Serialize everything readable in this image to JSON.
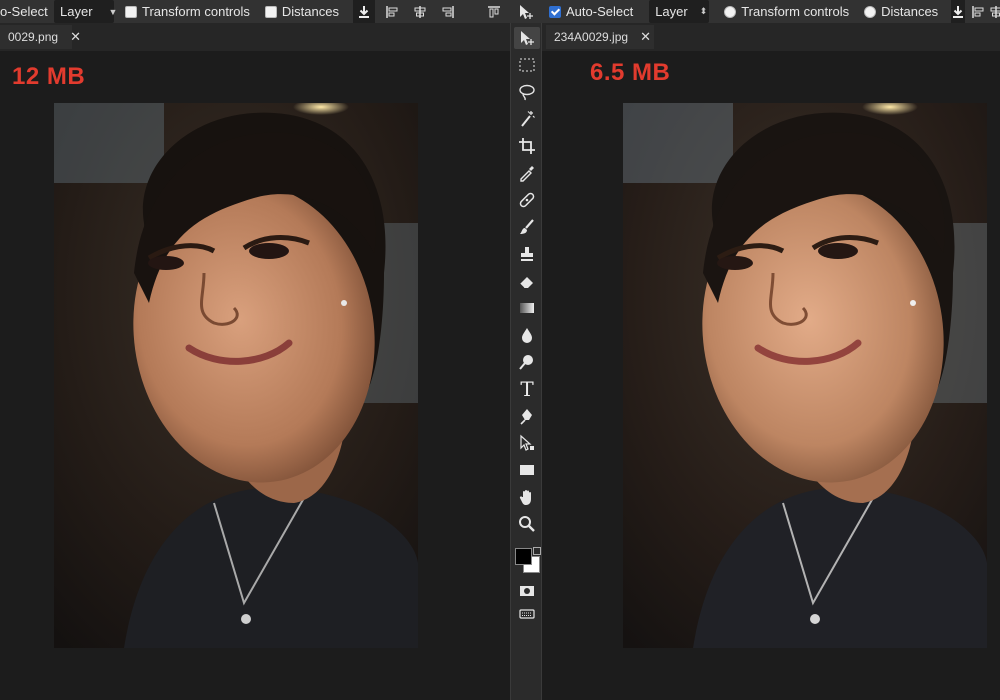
{
  "left_window": {
    "options_bar": {
      "auto_select_label": "o-Select",
      "layer_dropdown_value": "Layer",
      "transform_controls_label": "Transform controls",
      "transform_controls_checked": false,
      "distances_label": "Distances",
      "distances_checked": false
    },
    "tab": {
      "filename": "0029.png",
      "close_glyph": "✕"
    },
    "size_label": "12 MB"
  },
  "right_window": {
    "options_bar": {
      "auto_select_label": "Auto-Select",
      "auto_select_checked": true,
      "layer_dropdown_value": "Layer",
      "transform_controls_label": "Transform controls",
      "transform_controls_checked": false,
      "distances_label": "Distances",
      "distances_checked": false
    },
    "tab": {
      "filename": "234A0029.jpg",
      "close_glyph": "✕"
    },
    "size_label": "6.5 MB"
  },
  "tools": [
    {
      "name": "move-tool",
      "icon": "move-icon"
    },
    {
      "name": "marquee-tool",
      "icon": "marquee-icon"
    },
    {
      "name": "lasso-tool",
      "icon": "lasso-icon"
    },
    {
      "name": "magic-wand-tool",
      "icon": "magic-wand-icon"
    },
    {
      "name": "crop-tool",
      "icon": "crop-icon"
    },
    {
      "name": "eyedropper-tool",
      "icon": "eyedropper-icon"
    },
    {
      "name": "healing-tool",
      "icon": "bandage-icon"
    },
    {
      "name": "brush-tool",
      "icon": "brush-icon"
    },
    {
      "name": "stamp-tool",
      "icon": "stamp-icon"
    },
    {
      "name": "eraser-tool",
      "icon": "eraser-icon"
    },
    {
      "name": "gradient-tool",
      "icon": "gradient-icon"
    },
    {
      "name": "blur-tool",
      "icon": "drop-icon"
    },
    {
      "name": "dodge-tool",
      "icon": "dodge-icon"
    },
    {
      "name": "type-tool",
      "icon": "type-icon",
      "glyph": "T"
    },
    {
      "name": "pen-tool",
      "icon": "pen-icon"
    },
    {
      "name": "path-select-tool",
      "icon": "path-select-icon"
    },
    {
      "name": "shape-tool",
      "icon": "rectangle-icon"
    },
    {
      "name": "hand-tool",
      "icon": "hand-icon"
    },
    {
      "name": "zoom-tool",
      "icon": "zoom-icon"
    }
  ],
  "colors": {
    "foreground": "#000000",
    "background": "#ffffff",
    "size_label": "#e23b2e",
    "panel_bg": "#1c1c1c",
    "toolbar_bg": "#2b2b2b"
  }
}
